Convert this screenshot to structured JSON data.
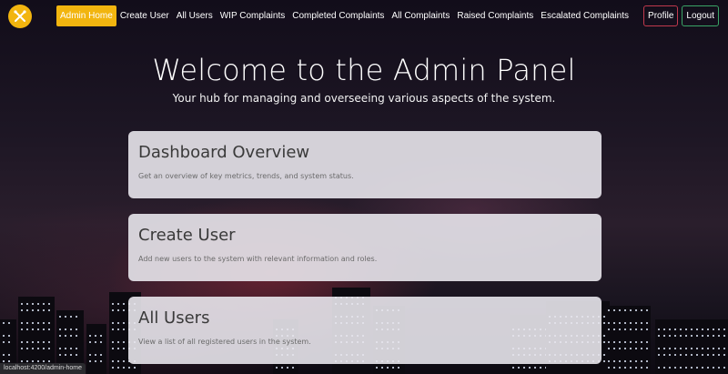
{
  "nav": {
    "links": [
      {
        "label": "Admin Home"
      },
      {
        "label": "Create User"
      },
      {
        "label": "All Users"
      },
      {
        "label": "WIP Complaints"
      },
      {
        "label": "Completed Complaints"
      },
      {
        "label": "All Complaints"
      },
      {
        "label": "Raised Complaints"
      },
      {
        "label": "Escalated Complaints"
      }
    ],
    "profile_label": "Profile",
    "logout_label": "Logout"
  },
  "hero": {
    "title": "Welcome to the Admin Panel",
    "subtitle": "Your hub for managing and overseeing various aspects of the system."
  },
  "cards": [
    {
      "title": "Dashboard Overview",
      "description": "Get an overview of key metrics, trends, and system status."
    },
    {
      "title": "Create User",
      "description": "Add new users to the system with relevant information and roles."
    },
    {
      "title": "All Users",
      "description": "View a list of all registered users in the system."
    }
  ],
  "status_bar": {
    "url": "localhost:4200/admin-home"
  },
  "colors": {
    "accent": "#f2b50f",
    "profile_border": "#c0394d",
    "logout_border": "#3aa466"
  },
  "icons": {
    "logo": "tools-icon"
  }
}
